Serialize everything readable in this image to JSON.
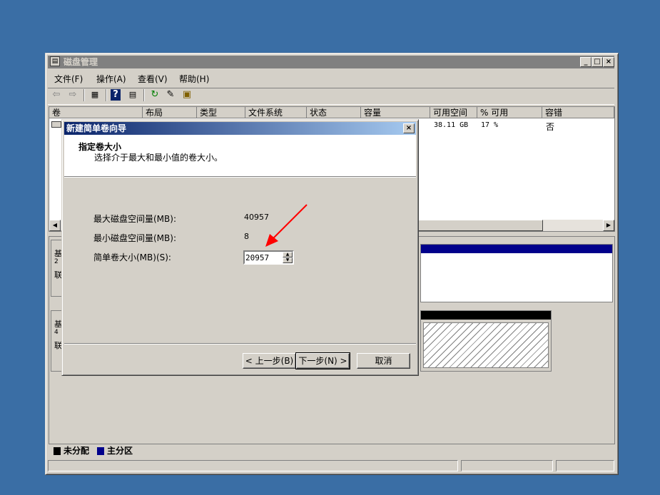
{
  "main_window": {
    "title": "磁盘管理",
    "menu": [
      "文件(F)",
      "操作(A)",
      "查看(V)",
      "帮助(H)"
    ],
    "columns": [
      "卷",
      "布局",
      "类型",
      "文件系统",
      "状态",
      "容量",
      "可用空间",
      "% 可用",
      "容错"
    ],
    "row": {
      "free": "38.11 GB",
      "pct": "17 %",
      "fault": "否"
    },
    "disk_panel_letters": [
      [
        "基",
        "2",
        "联"
      ],
      [
        "基",
        "4",
        "联"
      ]
    ],
    "legend": {
      "unallocated": "未分配",
      "primary": "主分区"
    }
  },
  "dialog": {
    "title": "新建简单卷向导",
    "heading": "指定卷大小",
    "subheading": "选择介于最大和最小值的卷大小。",
    "max_label": "最大磁盘空间量(MB):",
    "max_value": "40957",
    "min_label": "最小磁盘空间量(MB):",
    "min_value": "8",
    "size_label": "简单卷大小(MB)(S):",
    "size_value": "20957",
    "back_button": "< 上一步(B)",
    "next_button": "下一步(N) >",
    "cancel_button": "取消"
  },
  "colors": {
    "desktop": "#3a6ea5",
    "title_active": "#0a246a",
    "primary_partition": "#00008b",
    "annotation_arrow": "#ff0000"
  }
}
